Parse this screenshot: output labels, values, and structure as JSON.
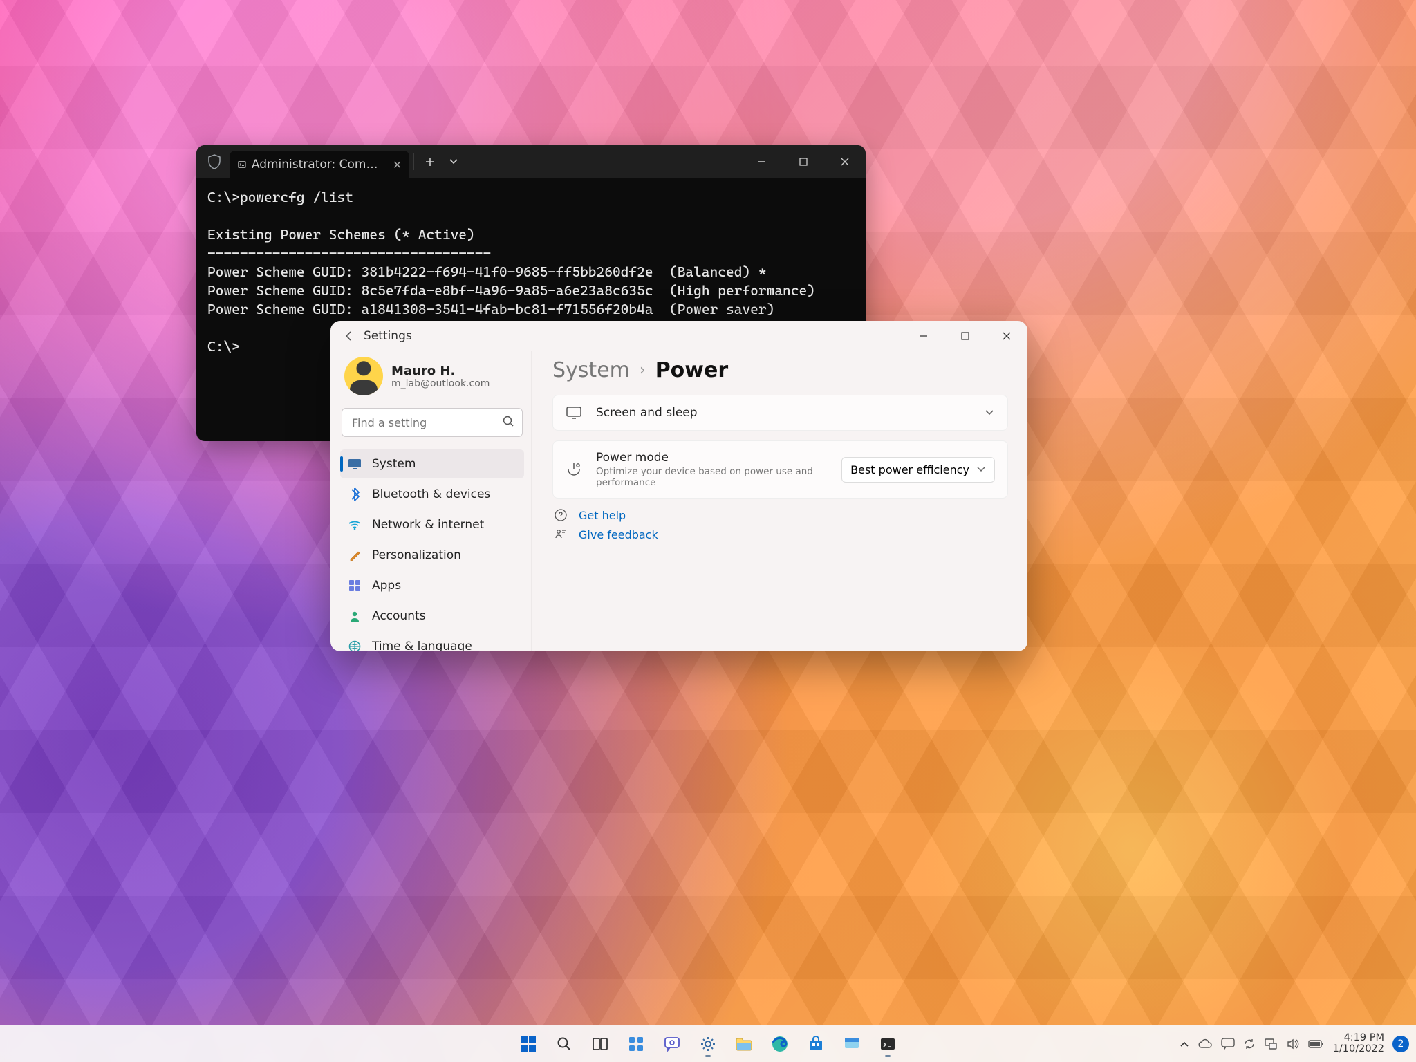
{
  "terminal": {
    "tab_title": "Administrator: Command Prom",
    "lines": [
      "C:\\>powercfg /list",
      "",
      "Existing Power Schemes (* Active)",
      "-----------------------------------",
      "Power Scheme GUID: 381b4222-f694-41f0-9685-ff5bb260df2e  (Balanced) *",
      "Power Scheme GUID: 8c5e7fda-e8bf-4a96-9a85-a6e23a8c635c  (High performance)",
      "Power Scheme GUID: a1841308-3541-4fab-bc81-f71556f20b4a  (Power saver)",
      "",
      "C:\\>"
    ]
  },
  "settings": {
    "title": "Settings",
    "user": {
      "name": "Mauro H.",
      "email": "m_lab@outlook.com"
    },
    "search_placeholder": "Find a setting",
    "nav": {
      "items": [
        {
          "label": "System",
          "active": true
        },
        {
          "label": "Bluetooth & devices",
          "active": false
        },
        {
          "label": "Network & internet",
          "active": false
        },
        {
          "label": "Personalization",
          "active": false
        },
        {
          "label": "Apps",
          "active": false
        },
        {
          "label": "Accounts",
          "active": false
        },
        {
          "label": "Time & language",
          "active": false
        }
      ]
    },
    "breadcrumb": {
      "parent": "System",
      "current": "Power"
    },
    "cards": {
      "screen_sleep": {
        "title": "Screen and sleep"
      },
      "power_mode": {
        "title": "Power mode",
        "subtitle": "Optimize your device based on power use and performance",
        "value": "Best power efficiency"
      }
    },
    "help": {
      "get_help": "Get help",
      "feedback": "Give feedback"
    }
  },
  "taskbar": {
    "time": "4:19 PM",
    "date": "1/10/2022",
    "badge": "2"
  }
}
